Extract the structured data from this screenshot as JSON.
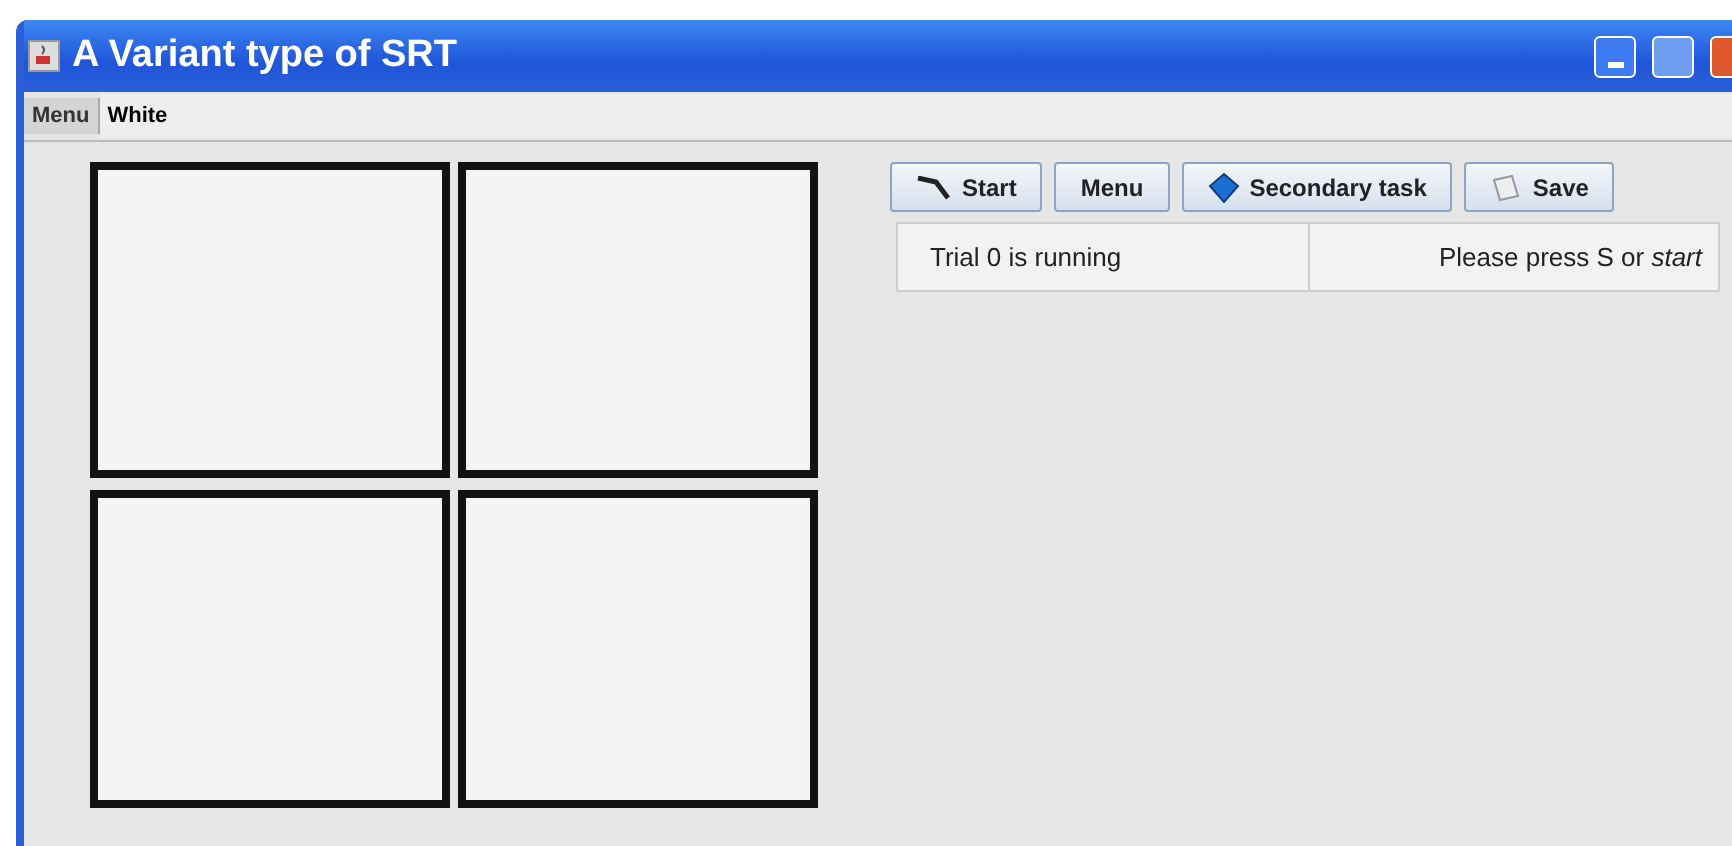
{
  "window": {
    "title": "A Variant type of SRT"
  },
  "menu_bar": {
    "menu": "Menu",
    "color_select": {
      "value": "White"
    }
  },
  "grid": {
    "squares": [
      {
        "kind": "square"
      },
      {
        "kind": "square"
      },
      {
        "kind": "square"
      },
      {
        "kind": "square"
      }
    ]
  },
  "toolbar": [
    {
      "label": "Start"
    },
    {
      "label": "Menu"
    },
    {
      "label": "Secondary task"
    },
    {
      "label": "Save"
    }
  ],
  "status": {
    "trial": "Trial 0 is running",
    "prompt": "Please press S or *start*"
  }
}
